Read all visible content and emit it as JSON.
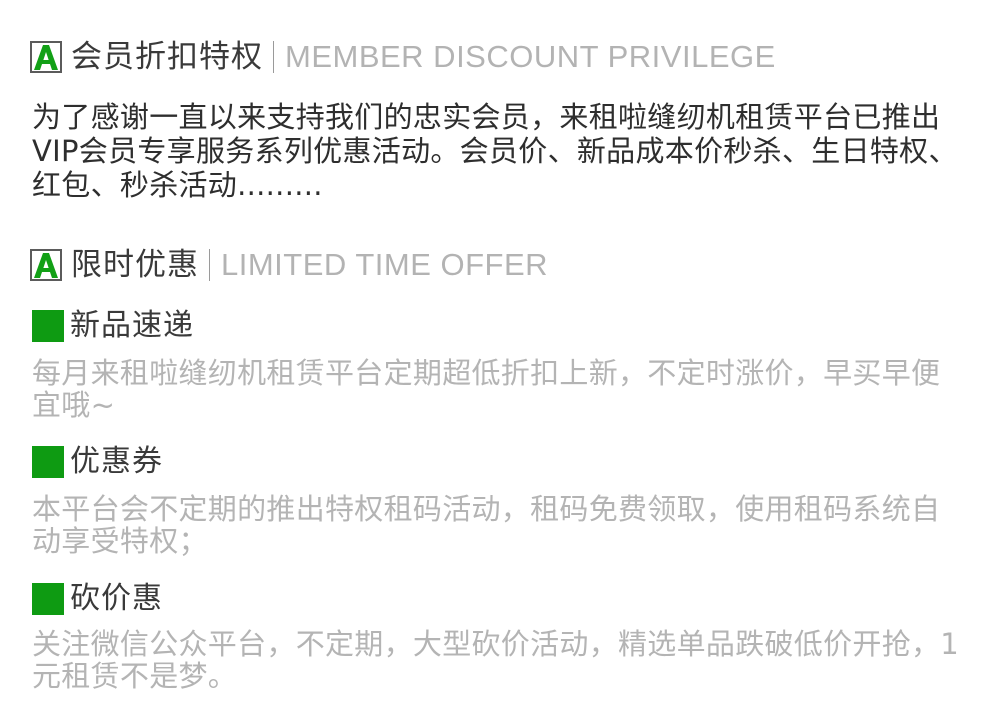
{
  "member_section": {
    "title_cn": "会员折扣特权",
    "title_en": "MEMBER DISCOUNT PRIVILEGE",
    "intro": "为了感谢一直以来支持我们的忠实会员，来租啦缝纫机租赁平台已推出VIP会员专享服务系列优惠活动。会员价、新品成本价秒杀、生日特权、红包、秒杀活动........."
  },
  "offer_section": {
    "title_cn": "限时优惠",
    "title_en": "LIMITED TIME OFFER",
    "items": [
      {
        "title": "新品速递",
        "text": "每月来租啦缝纫机租赁平台定期超低折扣上新，不定时涨价，早买早便宜哦~"
      },
      {
        "title": "优惠券",
        "text": "本平台会不定期的推出特权租码活动，租码免费领取，使用租码系统自动享受特权；"
      },
      {
        "title": "砍价惠",
        "text": "关注微信公众平台，不定期，大型砍价活动，精选单品跌破低价开抢，1元租赁不是梦。"
      }
    ]
  },
  "colors": {
    "accent_green": "#0e9b12",
    "heading_text": "#3a3a3a",
    "muted_text": "#b4b4b4"
  },
  "icons": {
    "logo": "letter-a-logo-icon",
    "bullet": "green-square-icon"
  }
}
